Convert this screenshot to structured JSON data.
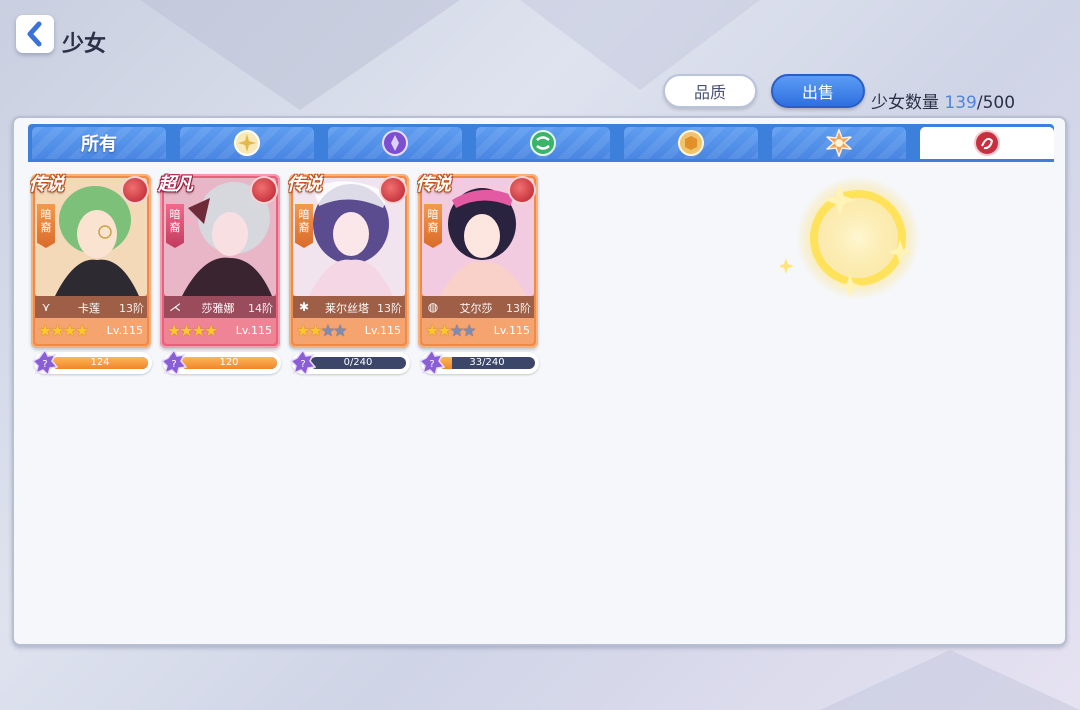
{
  "header": {
    "title": "少女",
    "back_icon": "chevron-left-icon"
  },
  "actions": {
    "quality_label": "品质",
    "sell_label": "出售"
  },
  "count": {
    "label": "少女数量",
    "current": "139",
    "separator": "/",
    "max": "500"
  },
  "tabs": [
    {
      "label": "所有",
      "icon": null,
      "color": ""
    },
    {
      "label": "",
      "icon": "light-element-icon",
      "color": "#f3d27a"
    },
    {
      "label": "",
      "icon": "dark-element-icon",
      "color": "#7b4fcf"
    },
    {
      "label": "",
      "icon": "wind-element-icon",
      "color": "#3cb36b"
    },
    {
      "label": "",
      "icon": "earth-element-icon",
      "color": "#e3a23c"
    },
    {
      "label": "",
      "icon": "fire-element-icon",
      "color": "#f08a3a"
    },
    {
      "label": "",
      "icon": "blood-element-icon",
      "color": "#c8303f",
      "active": true
    }
  ],
  "cards": [
    {
      "rank": "传说",
      "attribute": "暗裔",
      "name": "卡莲",
      "stage": "13阶",
      "level": "Lv.115",
      "stars_on": 4,
      "stars_total": 4,
      "class_icon": "wing-class-icon",
      "frag_text": "124",
      "frag_fill": 1.0,
      "rarity": "legend"
    },
    {
      "rank": "超凡",
      "attribute": "暗裔",
      "name": "莎雅娜",
      "stage": "14阶",
      "level": "Lv.115",
      "stars_on": 4,
      "stars_total": 4,
      "class_icon": "claw-class-icon",
      "frag_text": "120",
      "frag_fill": 1.0,
      "rarity": "super"
    },
    {
      "rank": "传说",
      "attribute": "暗裔",
      "name": "莱尔丝塔",
      "stage": "13阶",
      "level": "Lv.115",
      "stars_on": 2,
      "stars_total": 4,
      "class_icon": "spark-class-icon",
      "frag_text": "0/240",
      "frag_fill": 0.0,
      "rarity": "legend"
    },
    {
      "rank": "传说",
      "attribute": "暗裔",
      "name": "艾尔莎",
      "stage": "13阶",
      "level": "Lv.115",
      "stars_on": 2,
      "stars_total": 4,
      "class_icon": "shield-class-icon",
      "frag_text": "33/240",
      "frag_fill": 0.1375,
      "rarity": "legend"
    }
  ]
}
